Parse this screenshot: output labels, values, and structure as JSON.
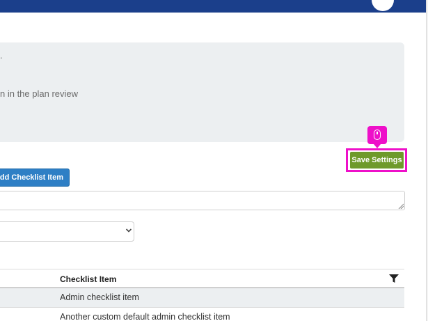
{
  "info_panel": {
    "line1_fragment": ".",
    "line2_fragment": "n in the plan review"
  },
  "toolbar": {
    "save_label": "Save Settings",
    "add_label": "Add Checklist Item"
  },
  "form": {
    "item_textarea_value": "",
    "category_select_value": ""
  },
  "table": {
    "columns": [
      "Checklist Item"
    ],
    "rows": [
      "Admin checklist item",
      "Another custom default admin checklist item"
    ]
  },
  "colors": {
    "topbar": "#1b3f8b",
    "save_button": "#6e9a2b",
    "add_button": "#2e7fc5",
    "highlight": "#ee10c9"
  },
  "icons": {
    "click_marker": "mouse-icon",
    "select_arrow": "chevron-down-icon",
    "column_filter": "filter-icon"
  }
}
